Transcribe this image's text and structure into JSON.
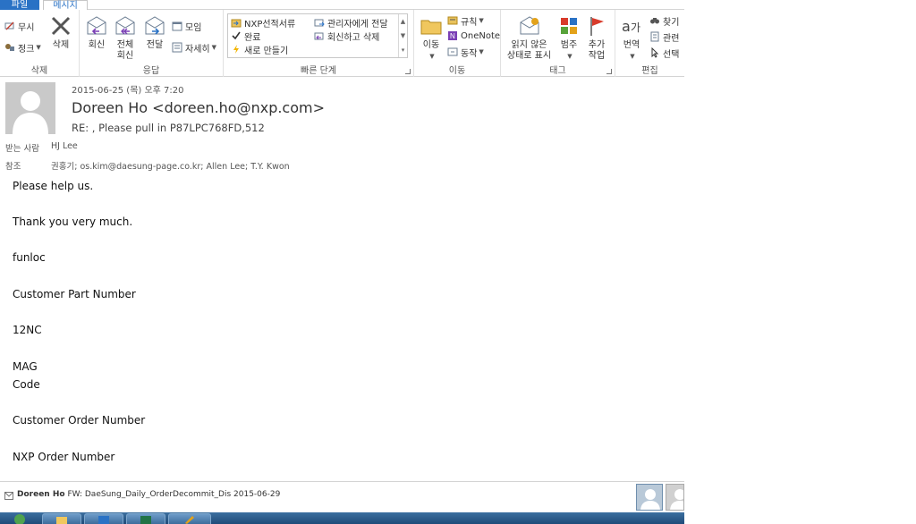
{
  "tabs": {
    "file": "파일",
    "message": "메시지"
  },
  "ribbon": {
    "delete_group": {
      "label": "삭제",
      "ignore": "무시",
      "cleanup": "정크",
      "delete": "삭제"
    },
    "respond_group": {
      "label": "응답",
      "reply": "회신",
      "reply_all_line1": "전체",
      "reply_all_line2": "회신",
      "forward": "전달",
      "meeting": "모임",
      "more": "자세히"
    },
    "quick_steps": {
      "label": "빠른 단계",
      "items": [
        "NXP선적서류",
        "관리자에게 전달",
        "완료",
        "회신하고 삭제",
        "새로 만들기"
      ]
    },
    "move_group": {
      "label": "이동",
      "move": "이동",
      "rules": "규칙",
      "onenote": "OneNote",
      "actions": "동작"
    },
    "tags_group": {
      "label": "태그",
      "mark_unread_line1": "읽지 않은",
      "mark_unread_line2": "상태로 표시",
      "categorize": "범주",
      "follow_up_line1": "추가",
      "follow_up_line2": "작업"
    },
    "editing_group": {
      "label": "편집",
      "translate": "번역",
      "find": "찾기",
      "related": "관련",
      "select": "선택"
    }
  },
  "message": {
    "date": "2015-06-25 (목) 오후 7:20",
    "sender": "Doreen Ho <doreen.ho@nxp.com>",
    "subject": "RE: , Please pull in P87LPC768FD,512",
    "to_label": "받는 사람",
    "to": "HJ Lee",
    "cc_label": "참조",
    "cc": "권홍기; os.kim@daesung-page.co.kr; Allen Lee; T.Y. Kwon"
  },
  "body": {
    "lines": [
      "Please help us.",
      "Thank you very much.",
      "funloc",
      "Customer Part Number",
      "12NC",
      "MAG",
      "Code",
      "Customer Order Number",
      "NXP Order Number"
    ]
  },
  "people_pane": {
    "sender": "Doreen Ho",
    "item": "FW: DaeSung_Daily_OrderDecommit_Dis 2015-06-29"
  },
  "taskbar": {
    "items": [
      "start-orb",
      "explorer-icon",
      "outlook-icon",
      "excel-icon",
      "paint-icon"
    ]
  },
  "colors": {
    "accent": "#2a72c5",
    "taskbar": "#1f4b78",
    "flag_red": "#d83b2b"
  }
}
